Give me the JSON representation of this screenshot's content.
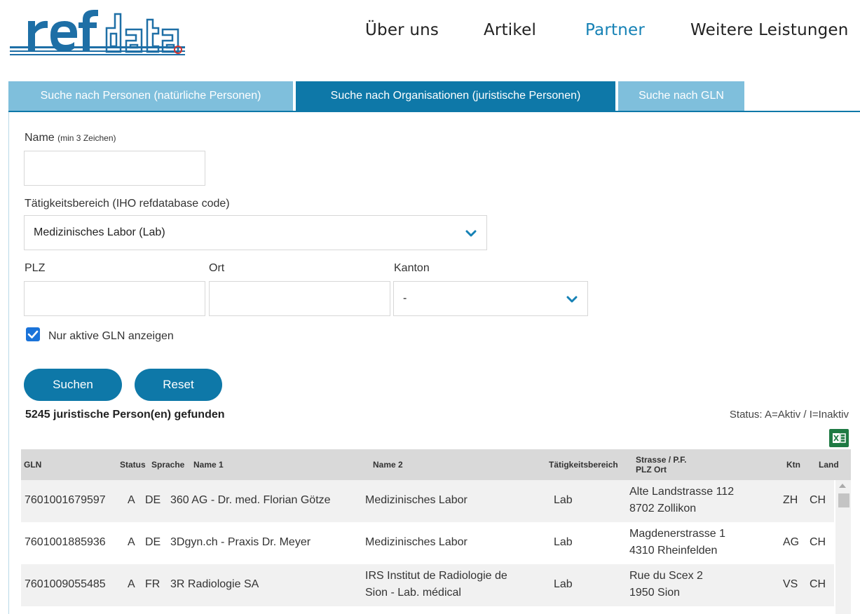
{
  "header": {
    "logo_text": "refdata",
    "nav": [
      {
        "label": "Über uns",
        "active": false
      },
      {
        "label": "Artikel",
        "active": false
      },
      {
        "label": "Partner",
        "active": true
      },
      {
        "label": "Weitere Leistungen",
        "active": false
      }
    ]
  },
  "tabs": [
    {
      "label": "Suche nach Personen (natürliche Personen)",
      "active": false
    },
    {
      "label": "Suche nach Organisationen (juristische Personen)",
      "active": true
    },
    {
      "label": "Suche nach GLN",
      "active": false
    }
  ],
  "form": {
    "name_label": "Name",
    "name_hint": "(min 3 Zeichen)",
    "name_value": "",
    "activity_label": "Tätigkeitsbereich (IHO refdatabase code)",
    "activity_value": "Medizinisches Labor (Lab)",
    "plz_label": "PLZ",
    "ort_label": "Ort",
    "kanton_label": "Kanton",
    "kanton_value": "-",
    "active_only_label": "Nur aktive GLN anzeigen",
    "active_only_checked": true,
    "search_button": "Suchen",
    "reset_button": "Reset"
  },
  "results": {
    "count_text": "5245 juristische Person(en) gefunden",
    "status_legend": "Status: A=Aktiv / I=Inaktiv",
    "headers": {
      "gln": "GLN",
      "status": "Status",
      "sprache": "Sprache",
      "name1": "Name 1",
      "name2": "Name 2",
      "bereich": "Tätigkeitsbereich",
      "strasse": "Strasse / P.F.",
      "plz_ort": "PLZ Ort",
      "ktn": "Ktn",
      "land": "Land"
    },
    "rows": [
      {
        "gln": "7601001679597",
        "status": "A",
        "sprache": "DE",
        "name1": "360 AG - Dr. med. Florian Götze",
        "name2a": "Medizinisches Labor",
        "name2b": "",
        "bereich": "Lab",
        "strasse": "Alte Landstrasse 112",
        "plz_ort": "8702 Zollikon",
        "ktn": "ZH",
        "land": "CH"
      },
      {
        "gln": "7601001885936",
        "status": "A",
        "sprache": "DE",
        "name1": "3Dgyn.ch - Praxis Dr. Meyer",
        "name2a": "Medizinisches Labor",
        "name2b": "",
        "bereich": "Lab",
        "strasse": "Magdenerstrasse 1",
        "plz_ort": "4310 Rheinfelden",
        "ktn": "AG",
        "land": "CH"
      },
      {
        "gln": "7601009055485",
        "status": "A",
        "sprache": "FR",
        "name1": "3R Radiologie SA",
        "name2a": "IRS Institut de Radiologie de",
        "name2b": "Sion - Lab. médical",
        "bereich": "Lab",
        "strasse": "Rue du Scex 2",
        "plz_ort": "1950 Sion",
        "ktn": "VS",
        "land": "CH"
      }
    ]
  },
  "colors": {
    "accent": "#0e78a8",
    "tab_inactive": "#7fbfdc",
    "nav_active": "#1581b5",
    "checkbox": "#1a73d9",
    "excel_green": "#1e7a43"
  }
}
